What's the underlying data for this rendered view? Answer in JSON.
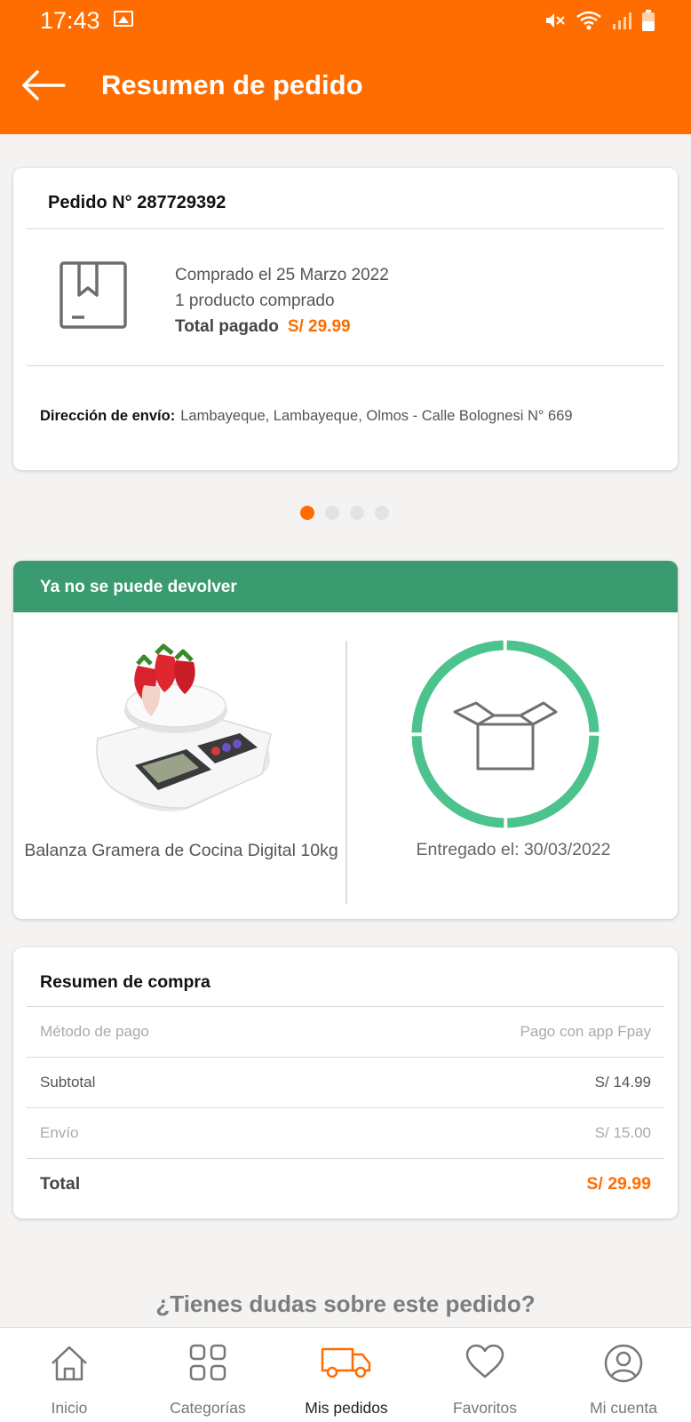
{
  "status_bar": {
    "time": "17:43"
  },
  "header": {
    "title": "Resumen de pedido"
  },
  "order": {
    "number_label": "Pedido N° 287729392",
    "purchased": "Comprado el 25 Marzo 2022",
    "products": "1 producto comprado",
    "total_label": "Total pagado",
    "total_value": "S/ 29.99",
    "address_label": "Dirección de envío:",
    "address_value": "Lambayeque, Lambayeque, Olmos - Calle Bolognesi N° 669"
  },
  "carousel": {
    "pages": 4,
    "active_page": 1
  },
  "shipment": {
    "status_header": "Ya no se puede devolver",
    "product_name": "Balanza Gramera de Cocina Digital 10kg",
    "delivered": "Entregado el: 30/03/2022"
  },
  "summary": {
    "title": "Resumen de compra",
    "payment_label": "Método de pago",
    "payment_value": "Pago con app Fpay",
    "subtotal_label": "Subtotal",
    "subtotal_value": "S/ 14.99",
    "shipping_label": "Envío",
    "shipping_value": "S/ 15.00",
    "total_label": "Total",
    "total_value": "S/ 29.99"
  },
  "help": {
    "question": "¿Tienes dudas sobre este pedido?"
  },
  "nav": {
    "items": [
      {
        "label": "Inicio",
        "icon": "home-icon"
      },
      {
        "label": "Categorías",
        "icon": "grid-icon"
      },
      {
        "label": "Mis pedidos",
        "icon": "truck-icon"
      },
      {
        "label": "Favoritos",
        "icon": "heart-icon"
      },
      {
        "label": "Mi cuenta",
        "icon": "account-icon"
      }
    ],
    "active": "Mis pedidos"
  },
  "colors": {
    "brand": "#ff6d00",
    "status_green": "#3a9b70",
    "ring_green": "#4cc38c"
  }
}
